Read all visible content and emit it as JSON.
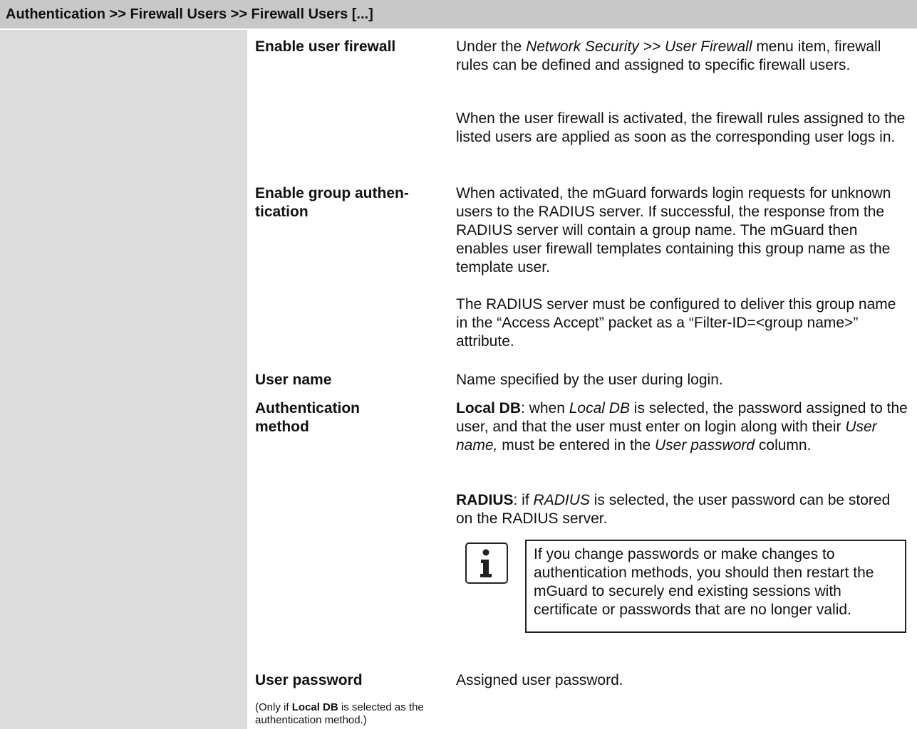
{
  "header": {
    "title": "Authentication >> Firewall Users >> Firewall Users [...]"
  },
  "rows": {
    "enable_user_firewall": {
      "label": "Enable user firewall",
      "p1": {
        "a": "Under the ",
        "b": "Network Security >> User Firewall",
        "c": " menu item, firewall rules can be defined and assigned to specific firewall users."
      },
      "p2": "When the user firewall is activated, the firewall rules assigned to the listed users are applied as soon as the corresponding user logs in."
    },
    "enable_group_auth": {
      "label_line1": "Enable group authen-",
      "label_line2": "tication",
      "p1": "When activated, the mGuard forwards login requests for unknown users to the RADIUS server. If successful, the response from the RADIUS server will contain a group name. The mGuard then enables user firewall templates containing this group name as the template user.",
      "p2": "The RADIUS server must be configured to deliver this group name in the “Access Accept” packet as a “Filter-ID=<group name>” attribute."
    },
    "user_name": {
      "label": "User name",
      "desc": "Name specified by the user during login."
    },
    "auth_method": {
      "label_line1": "Authentication",
      "label_line2": "method",
      "local_db": {
        "term": "Local DB",
        "a": ": when ",
        "b": "Local DB",
        "c": " is selected, the password assigned to the user, and that the user must enter on login along with their ",
        "d": "User name,",
        "e": " must be entered in the ",
        "f": "User password",
        "g": " column."
      },
      "radius": {
        "term": "RADIUS",
        "a": ": if ",
        "b": "RADIUS",
        "c": " is selected, the user password can be stored on the RADIUS server."
      },
      "note": "If you change passwords or make changes to authentication methods, you should then restart the mGuard to securely end existing sessions with certificate or passwords that are no longer valid.",
      "note_icon": "info-icon"
    },
    "user_password": {
      "label": "User password",
      "desc": "Assigned user password.",
      "note_a": "(Only if ",
      "note_b": "Local DB",
      "note_c": " is selected as the authentication method.)"
    }
  }
}
